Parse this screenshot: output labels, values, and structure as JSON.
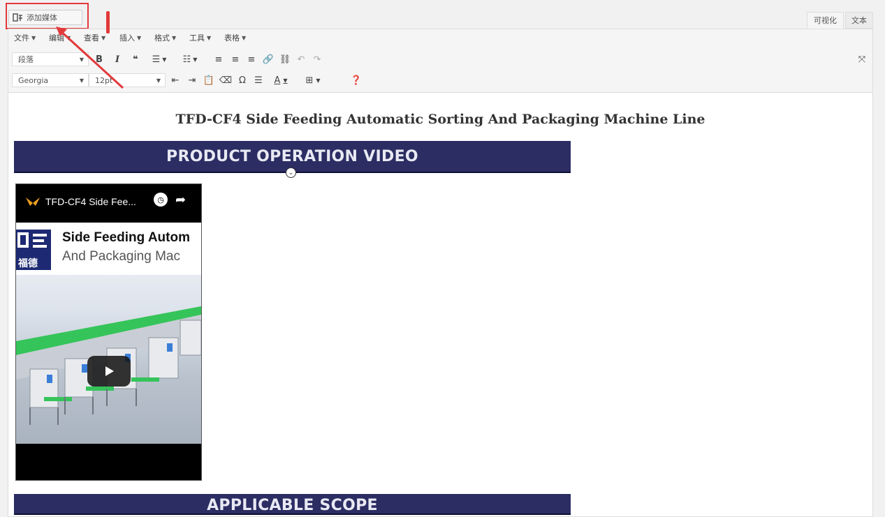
{
  "add_media": {
    "label": "添加媒体"
  },
  "editor_tabs": {
    "visual": "可视化",
    "text": "文本"
  },
  "menubar": [
    {
      "label": "文件"
    },
    {
      "label": "编辑"
    },
    {
      "label": "查看"
    },
    {
      "label": "插入"
    },
    {
      "label": "格式"
    },
    {
      "label": "工具"
    },
    {
      "label": "表格"
    }
  ],
  "toolbar": {
    "block_format": "段落",
    "font_family": "Georgia",
    "font_size": "12pt"
  },
  "content": {
    "title": "TFD-CF4 Side Feeding Automatic Sorting And Packaging Machine Line",
    "banner1": "PRODUCT OPERATION VIDEO",
    "banner2": "APPLICABLE SCOPE",
    "video": {
      "title": "TFD-CF4 Side Fee...",
      "logo_text": "福德",
      "thumb_line1": "Side Feeding Autom",
      "thumb_line2": "And Packaging Mac"
    }
  },
  "colors": {
    "banner": "#2b2d63",
    "highlight": "#e2393b",
    "conveyor": "#35c45a"
  }
}
